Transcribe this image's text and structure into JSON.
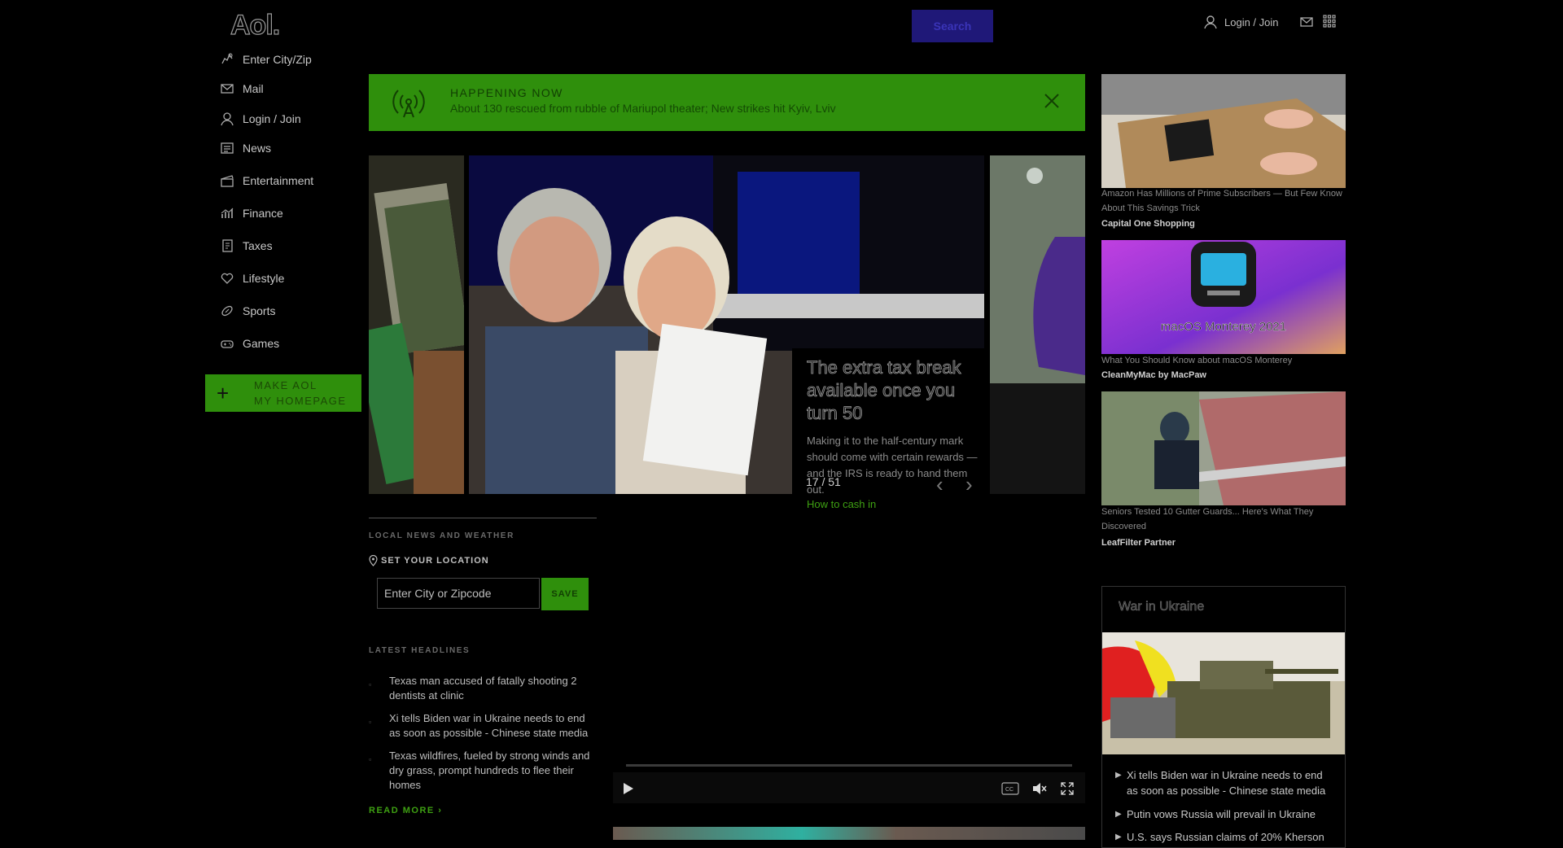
{
  "header": {
    "logo": "Aol.",
    "search_label": "Search",
    "login_label": "Login / Join"
  },
  "nav": {
    "items": [
      {
        "label": "Enter City/Zip",
        "icon": "location-icon"
      },
      {
        "label": "Mail",
        "icon": "mail-icon"
      },
      {
        "label": "Login / Join",
        "icon": "user-icon"
      },
      {
        "label": "News",
        "icon": "news-icon"
      },
      {
        "label": "Entertainment",
        "icon": "clapper-icon"
      },
      {
        "label": "Finance",
        "icon": "chart-icon"
      },
      {
        "label": "Taxes",
        "icon": "tax-document-icon"
      },
      {
        "label": "Lifestyle",
        "icon": "heart-icon"
      },
      {
        "label": "Sports",
        "icon": "football-icon"
      },
      {
        "label": "Games",
        "icon": "gamepad-icon"
      }
    ],
    "make_homepage_line1": "MAKE AOL",
    "make_homepage_line2": "MY HOMEPAGE"
  },
  "banner": {
    "label": "HAPPENING NOW",
    "text": "About 130 rescued from rubble of Mariupol theater; New strikes hit Kyiv, Lviv"
  },
  "carousel": {
    "title": "The extra tax break available once you turn 50",
    "description": "Making it to the half-century mark should come with certain rewards — and the IRS is ready to hand them out.",
    "link": "How to cash in",
    "counter": "17 / 51"
  },
  "local": {
    "section_label": "LOCAL NEWS AND WEATHER",
    "set_location": "SET YOUR LOCATION",
    "zip_placeholder": "Enter City or Zipcode",
    "save_label": "SAVE"
  },
  "headlines": {
    "section_label": "LATEST HEADLINES",
    "items": [
      "Texas man accused of fatally shooting 2 dentists at clinic",
      "Xi tells Biden war in Ukraine needs to end as soon as possible - Chinese state media",
      "Texas wildfires, fueled by strong winds and dry grass, prompt hundreds to flee their homes"
    ],
    "read_more": "READ MORE ›"
  },
  "ads": [
    {
      "title": "Amazon Has Millions of Prime Subscribers — But Few Know About This Savings Trick",
      "source": "Capital One Shopping"
    },
    {
      "title": "What You Should Know about macOS Monterey",
      "source": "CleanMyMac by MacPaw",
      "image_text": "macOS Monterey 2021"
    },
    {
      "title": "Seniors Tested 10 Gutter Guards... Here's What They Discovered",
      "source": "LeafFilter Partner"
    }
  ],
  "ukraine": {
    "title": "War in Ukraine",
    "items": [
      "Xi tells Biden war in Ukraine needs to end as soon as possible - Chinese state media",
      "Putin vows Russia will prevail in Ukraine",
      "U.S. says Russian claims of 20% Kherson"
    ]
  },
  "colors": {
    "accent_green": "#2f8f0c",
    "search_blue": "#1f1878",
    "background": "#000000"
  }
}
